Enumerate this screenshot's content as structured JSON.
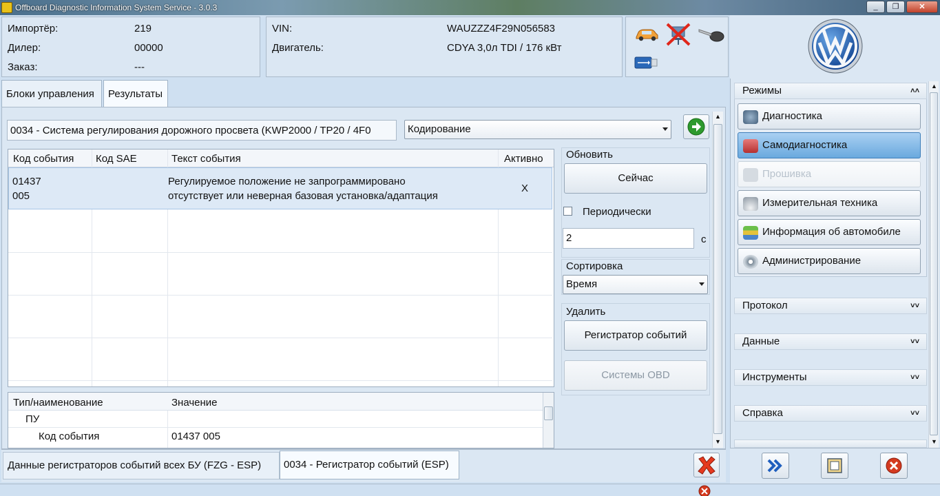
{
  "window": {
    "title": "Offboard Diagnostic Information System Service - 3.0.3",
    "controls": [
      "minimize",
      "maximize",
      "close"
    ]
  },
  "header": {
    "importer_label": "Импортёр:",
    "importer_value": "219",
    "dealer_label": "Дилер:",
    "dealer_value": "00000",
    "order_label": "Заказ:",
    "order_value": "---",
    "vin_label": "VIN:",
    "vin_value": "WAUZZZ4F29N056583",
    "engine_label": "Двигатель:",
    "engine_value": "CDYA 3,0л TDI / 176 кВт",
    "status_icons": [
      "car-icon",
      "network-disconnected-icon",
      "key-icon",
      "usb-icon"
    ]
  },
  "tabs": [
    {
      "label": "Блоки управления",
      "active": false
    },
    {
      "label": "Результаты",
      "active": true
    }
  ],
  "control_unit": {
    "title": "0034 - Система регулирования дорожного просвета  (KWP2000 / TP20 / 4F0",
    "mode_select": "Кодирование"
  },
  "events_table": {
    "columns": [
      "Код события",
      "Код SAE",
      "Текст события",
      "Активно"
    ],
    "rows": [
      {
        "code_line1": "01437",
        "code_line2": "005",
        "sae": "",
        "text_line1": "Регулируемое положение не запрограммировано",
        "text_line2": "отсутствует или неверная базовая установка/адаптация",
        "active": "X"
      }
    ]
  },
  "details_table": {
    "columns": [
      "Тип/наименование",
      "Значение"
    ],
    "rows": [
      {
        "name": "ПУ",
        "value": ""
      },
      {
        "name": "Код события",
        "value": "01437 005"
      }
    ]
  },
  "side_controls": {
    "refresh_label": "Обновить",
    "now_button": "Сейчас",
    "periodic_label": "Периодически",
    "periodic_checked": false,
    "interval_value": "2",
    "interval_unit": "с",
    "sort_label": "Сортировка",
    "sort_value": "Время",
    "delete_label": "Удалить",
    "event_recorder_button": "Регистратор событий",
    "obd_button": "Системы OBD"
  },
  "bottom_tabs": [
    "Данные регистраторов событий всех БУ (FZG - ESP)",
    "0034 - Регистратор событий (ESP)"
  ],
  "right_panel": {
    "modes_title": "Режимы",
    "modes": [
      {
        "label": "Диагностика",
        "icon": "stethoscope-icon",
        "state": "normal"
      },
      {
        "label": "Самодиагностика",
        "icon": "car-diagnosis-icon",
        "state": "selected"
      },
      {
        "label": "Прошивка",
        "icon": "flash-icon",
        "state": "disabled"
      },
      {
        "label": "Измерительная техника",
        "icon": "gauge-icon",
        "state": "normal"
      },
      {
        "label": "Информация об автомобиле",
        "icon": "books-icon",
        "state": "normal"
      },
      {
        "label": "Администрирование",
        "icon": "gear-icon",
        "state": "normal"
      }
    ],
    "sections": [
      "Протокол",
      "Данные",
      "Инструменты",
      "Справка"
    ]
  },
  "colors": {
    "background": "#cfe0f1",
    "panel": "#dbe7f3",
    "selected_row": "#dde9f6",
    "selected_mode": "#6aa9de",
    "close_red": "#d43a1f",
    "go_green": "#2e9a2e"
  }
}
